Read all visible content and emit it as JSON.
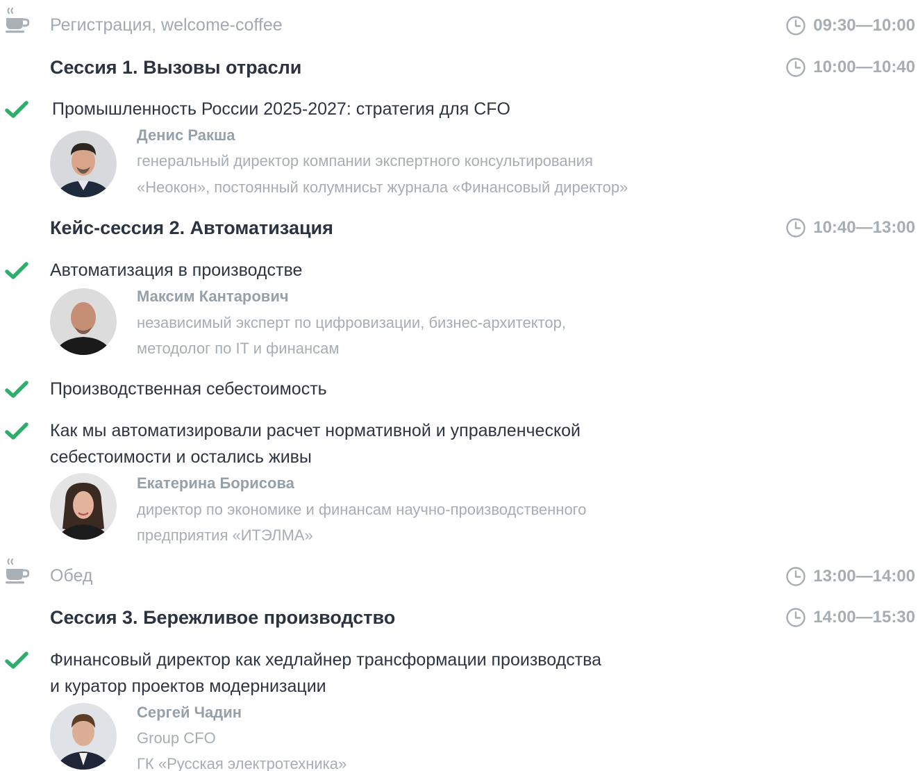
{
  "agenda": {
    "registration": {
      "title": "Регистрация, welcome-coffee",
      "time": "09:30—10:00"
    },
    "session1": {
      "title": "Сессия 1. Вызовы отрасли",
      "time": "10:00—10:40",
      "talk1": {
        "title": "Промышленность России 2025-2027: стратегия для CFO",
        "speaker_name": "Денис Ракша",
        "speaker_role_line1": "генеральный директор компании экспертного консультирования",
        "speaker_role_line2": "«Неокон», постоянный колумнисьт журнала «Финансовый директор»"
      }
    },
    "session2": {
      "title": "Кейс-сессия 2. Автоматизация",
      "time": "10:40—13:00",
      "talk1": {
        "title": "Автоматизация в производстве",
        "speaker_name": "Максим Кантарович",
        "speaker_role_line1": "независимый эксперт по цифровизации, бизнес-архитектор,",
        "speaker_role_line2": "методолог по IT и финансам"
      },
      "talk2": {
        "title": "Производственная себестоимость"
      },
      "talk3": {
        "title_line1": "Как мы автоматизировали расчет нормативной  и управленческой",
        "title_line2": "себестоимости и остались живы",
        "speaker_name": "Екатерина Борисова",
        "speaker_role_line1": "директор по экономике и финансам научно-производственного",
        "speaker_role_line2": "предприятия «ИТЭЛМА»"
      }
    },
    "lunch": {
      "title": "Обед",
      "time": "13:00—14:00"
    },
    "session3": {
      "title": "Сессия 3. Бережливое производство",
      "time": "14:00—15:30",
      "talk1": {
        "title_line1": "Финансовый директор как хедлайнер трансформации производства",
        "title_line2": "и куратор проектов модернизации",
        "speaker_name": "Сергей Чадин",
        "speaker_role_line1": "Group CFO",
        "speaker_role_line2": "ГК «Русская электротехника»"
      }
    }
  },
  "icons": {
    "coffee": "coffee-cup-icon",
    "check": "checkmark-icon",
    "clock": "clock-icon"
  },
  "colors": {
    "check": "#2eae6b",
    "title_dark": "#2b3340",
    "muted": "#a6adb3"
  }
}
